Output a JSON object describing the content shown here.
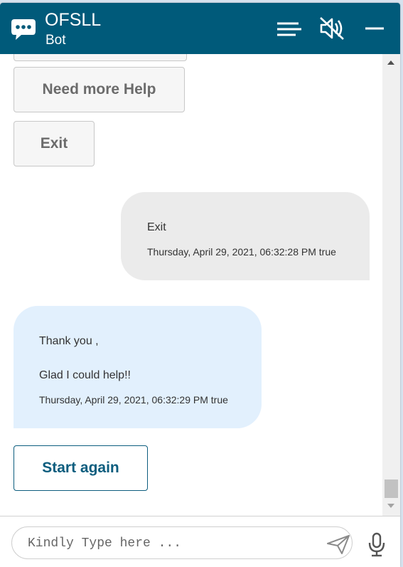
{
  "header": {
    "title": "OFSLL",
    "subtitle": "Bot",
    "icons": [
      "chat-bubble-icon",
      "menu-icon",
      "speaker-muted-icon",
      "minimize-icon"
    ],
    "color": "#005a7a"
  },
  "conversation": {
    "options": [
      {
        "label": ""
      },
      {
        "label": "Need more Help"
      },
      {
        "label": "Exit"
      }
    ],
    "user_message": {
      "text": "Exit",
      "timestamp": "Thursday, April 29, 2021, 06:32:28 PM true"
    },
    "bot_message": {
      "line1": "Thank you ,",
      "line2": "Glad I could help!!",
      "timestamp": "Thursday, April 29, 2021, 06:32:29 PM true"
    },
    "start_again_label": "Start again"
  },
  "footer": {
    "placeholder": "Kindly Type here ...",
    "value": "",
    "icons": [
      "send-icon",
      "microphone-icon"
    ]
  },
  "colors": {
    "accent": "#0c5d7e",
    "user_bubble": "#ebebeb",
    "bot_bubble": "#e2f0fd"
  }
}
